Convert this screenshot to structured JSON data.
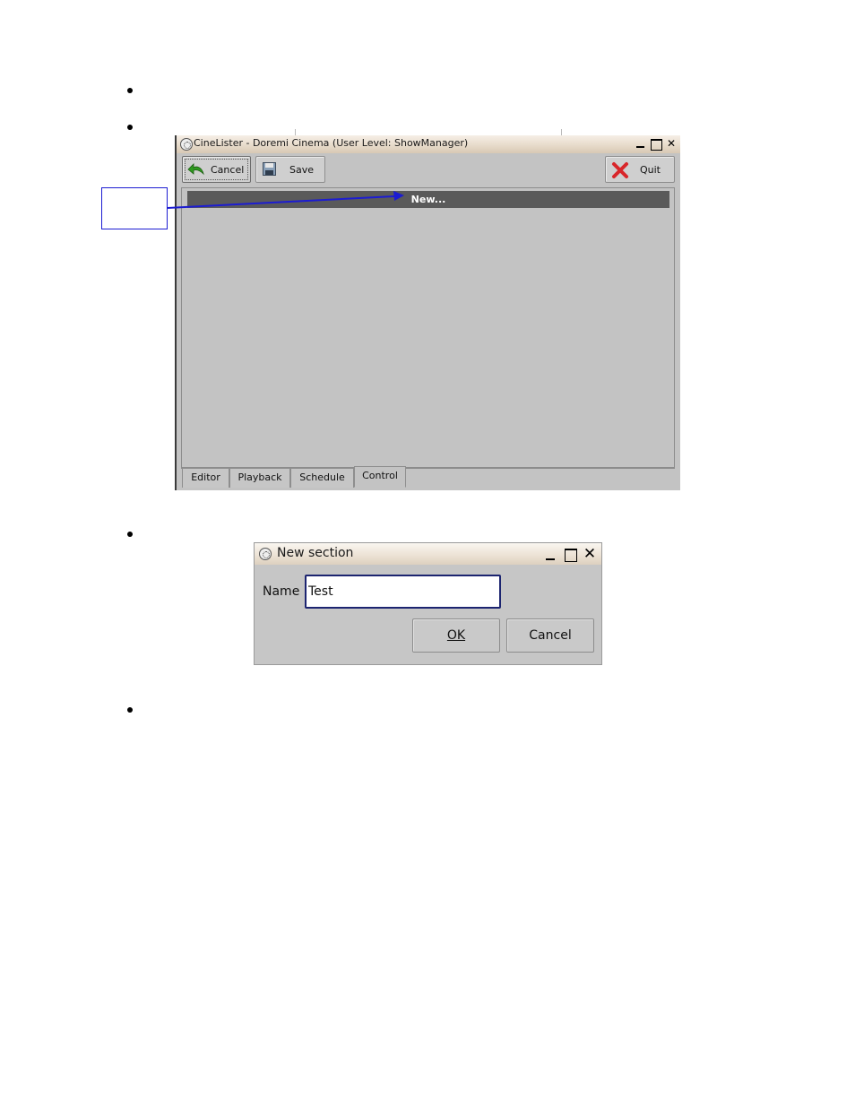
{
  "main_window": {
    "title": "CineLister - Doremi Cinema (User Level: ShowManager)",
    "toolbar": {
      "cancel_label": "Cancel",
      "save_label": "Save",
      "quit_label": "Quit"
    },
    "list": {
      "items": [
        "New..."
      ]
    },
    "tabs": [
      "Editor",
      "Playback",
      "Schedule",
      "Control"
    ],
    "active_tab": "Control"
  },
  "dialog": {
    "title": "New section",
    "name_label": "Name",
    "name_value": "Test",
    "ok_label": "OK",
    "cancel_label": "Cancel"
  },
  "colors": {
    "selection": "#5a5a5a",
    "window_bg": "#c3c3c3",
    "input_border": "#1c2470",
    "callout": "#1c1cd2"
  },
  "icons": {
    "cancel": "green-back-arrow-icon",
    "save": "floppy-disk-icon",
    "quit": "red-x-icon",
    "app": "film-reel-icon"
  }
}
